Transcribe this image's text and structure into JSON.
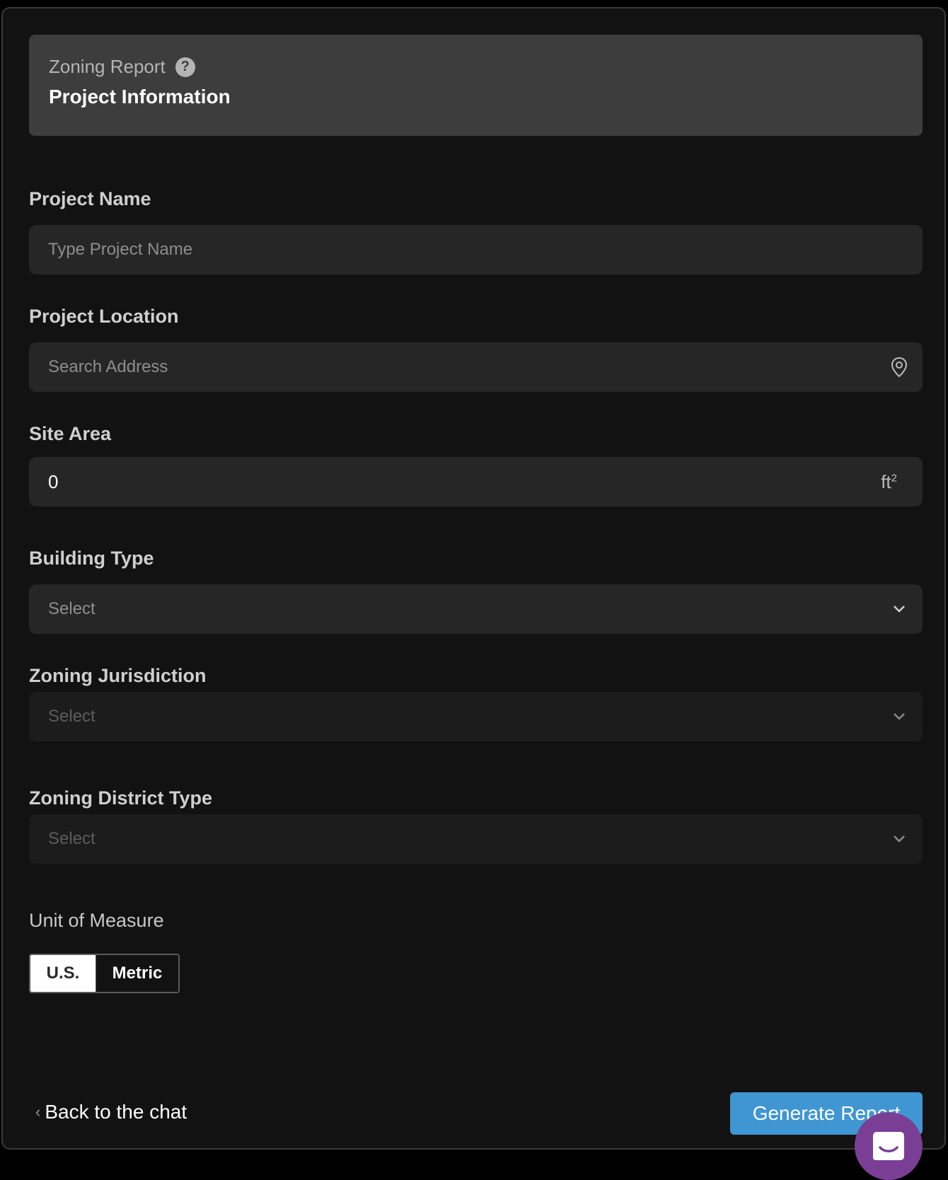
{
  "header": {
    "subtitle": "Zoning Report",
    "help_icon": "?",
    "title": "Project Information"
  },
  "fields": {
    "project_name": {
      "label": "Project Name",
      "placeholder": "Type Project Name"
    },
    "project_location": {
      "label": "Project Location",
      "placeholder": "Search Address",
      "icon": "location-pin-icon"
    },
    "site_area": {
      "label": "Site Area",
      "value": "0",
      "unit": "ft",
      "unit_exp": "2"
    },
    "building_type": {
      "label": "Building Type",
      "value": "Select"
    },
    "zoning_jurisdiction": {
      "label": "Zoning Jurisdiction",
      "value": "Select"
    },
    "zoning_district_type": {
      "label": "Zoning District Type",
      "value": "Select"
    }
  },
  "unit_of_measure": {
    "label": "Unit of Measure",
    "options": [
      "U.S.",
      "Metric"
    ],
    "selected": "U.S."
  },
  "footer": {
    "back_label": "Back to the chat",
    "back_chevron": "‹",
    "generate_label": "Generate Report"
  },
  "colors": {
    "accent": "#3f96d3",
    "chat_bubble": "#7a3e94"
  }
}
